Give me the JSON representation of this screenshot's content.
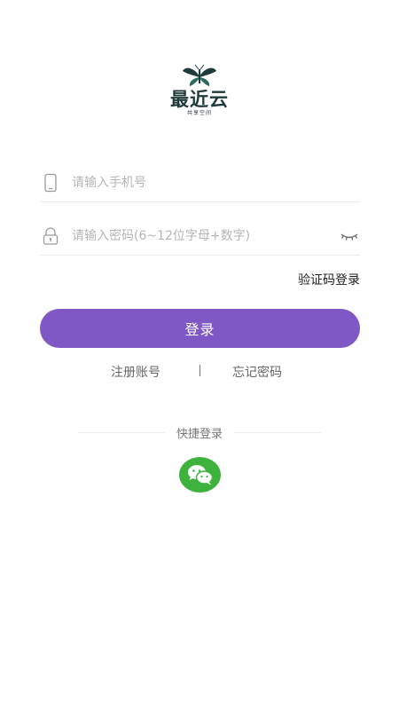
{
  "logo": {
    "name": "最近云",
    "subtitle": "共享空间"
  },
  "login_form": {
    "phone_placeholder": "请输入手机号",
    "password_placeholder": "请输入密码(6~12位字母+数字)",
    "sms_login_label": "验证码登录",
    "submit_label": "登录"
  },
  "links": {
    "register_label": "注册账号",
    "forgot_label": "忘记密码"
  },
  "quick_login": {
    "label": "快捷登录",
    "icons": [
      "wechat-icon"
    ]
  },
  "colors": {
    "primary": "#7f58c5",
    "wechat": "#3db23d",
    "logo": "#1f3a3a"
  }
}
